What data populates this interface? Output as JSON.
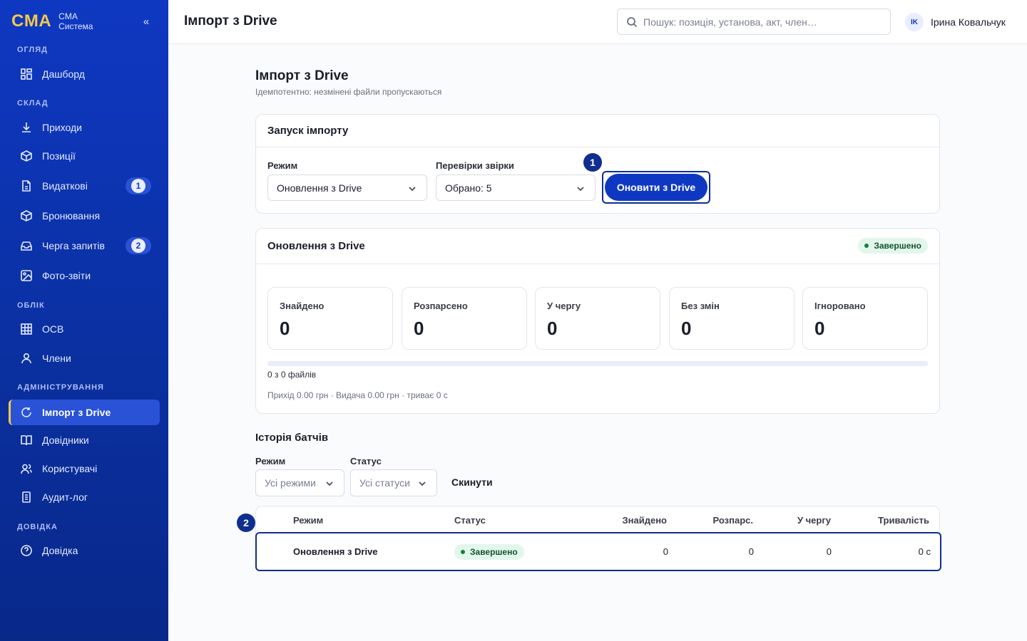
{
  "brand": {
    "logo": "CMA",
    "line1": "CMA",
    "line2": "Система",
    "collapse": "«"
  },
  "nav": {
    "sections": [
      "ОГЛЯД",
      "СКЛАД",
      "ОБЛІК",
      "АДМІНІСТРУВАННЯ",
      "ДОВІДКА"
    ],
    "items": [
      {
        "label": "Дашборд",
        "icon": "grid-icon"
      },
      {
        "label": "Приходи",
        "icon": "download-icon"
      },
      {
        "label": "Позиції",
        "icon": "box-icon"
      },
      {
        "label": "Видаткові",
        "icon": "document-icon",
        "badge": "1"
      },
      {
        "label": "Бронювання",
        "icon": "box-icon"
      },
      {
        "label": "Черга запитів",
        "icon": "inbox-icon",
        "badge": "2"
      },
      {
        "label": "Фото-звіти",
        "icon": "image-icon"
      },
      {
        "label": "ОСВ",
        "icon": "table-icon"
      },
      {
        "label": "Члени",
        "icon": "user-icon"
      },
      {
        "label": "Імпорт з Drive",
        "icon": "refresh-icon",
        "active": true
      },
      {
        "label": "Довідники",
        "icon": "book-icon"
      },
      {
        "label": "Користувачі",
        "icon": "users-icon"
      },
      {
        "label": "Аудит-лог",
        "icon": "log-icon"
      },
      {
        "label": "Довідка",
        "icon": "help-icon"
      }
    ]
  },
  "topbar": {
    "title": "Імпорт з Drive",
    "search_placeholder": "Пошук: позиція, установа, акт, член…",
    "user_initials": "IK",
    "user_name": "Ірина Ковальчук"
  },
  "page": {
    "title": "Імпорт з Drive",
    "subtitle": "Ідемпотентно: незмінені файли пропускаються"
  },
  "launch": {
    "title": "Запуск імпорту",
    "mode_label": "Режим",
    "mode_value": "Оновлення з Drive",
    "checks_label": "Перевірки звірки",
    "checks_value": "Обрано: 5",
    "step_badge": "1",
    "button": "Оновити з Drive"
  },
  "run": {
    "title": "Оновлення з Drive",
    "status": "Завершено",
    "stats": [
      {
        "label": "Знайдено",
        "value": "0"
      },
      {
        "label": "Розпарсено",
        "value": "0"
      },
      {
        "label": "У чергу",
        "value": "0"
      },
      {
        "label": "Без змін",
        "value": "0"
      },
      {
        "label": "Ігноровано",
        "value": "0"
      }
    ],
    "progress": 0,
    "progress_text": "0 з 0 файлів",
    "summary": "Прихід 0.00 грн · Видача 0.00 грн · триває 0 с"
  },
  "history": {
    "title": "Історія батчів",
    "mode_label": "Режим",
    "mode_value": "Усі режими",
    "status_label": "Статус",
    "status_value": "Усі статуси",
    "reset": "Скинути",
    "step_badge": "2",
    "columns": [
      "Режим",
      "Статус",
      "Знайдено",
      "Розпарс.",
      "У чергу",
      "Тривалість"
    ],
    "rows": [
      {
        "mode": "Оновлення з Drive",
        "status": "Завершено",
        "found": "0",
        "parsed": "0",
        "queued": "0",
        "duration": "0 с"
      }
    ]
  },
  "colors": {
    "sidebar": "#0f38c2",
    "accent": "#f5c84a",
    "primary": "#0f38c2",
    "success": "#15803d"
  }
}
